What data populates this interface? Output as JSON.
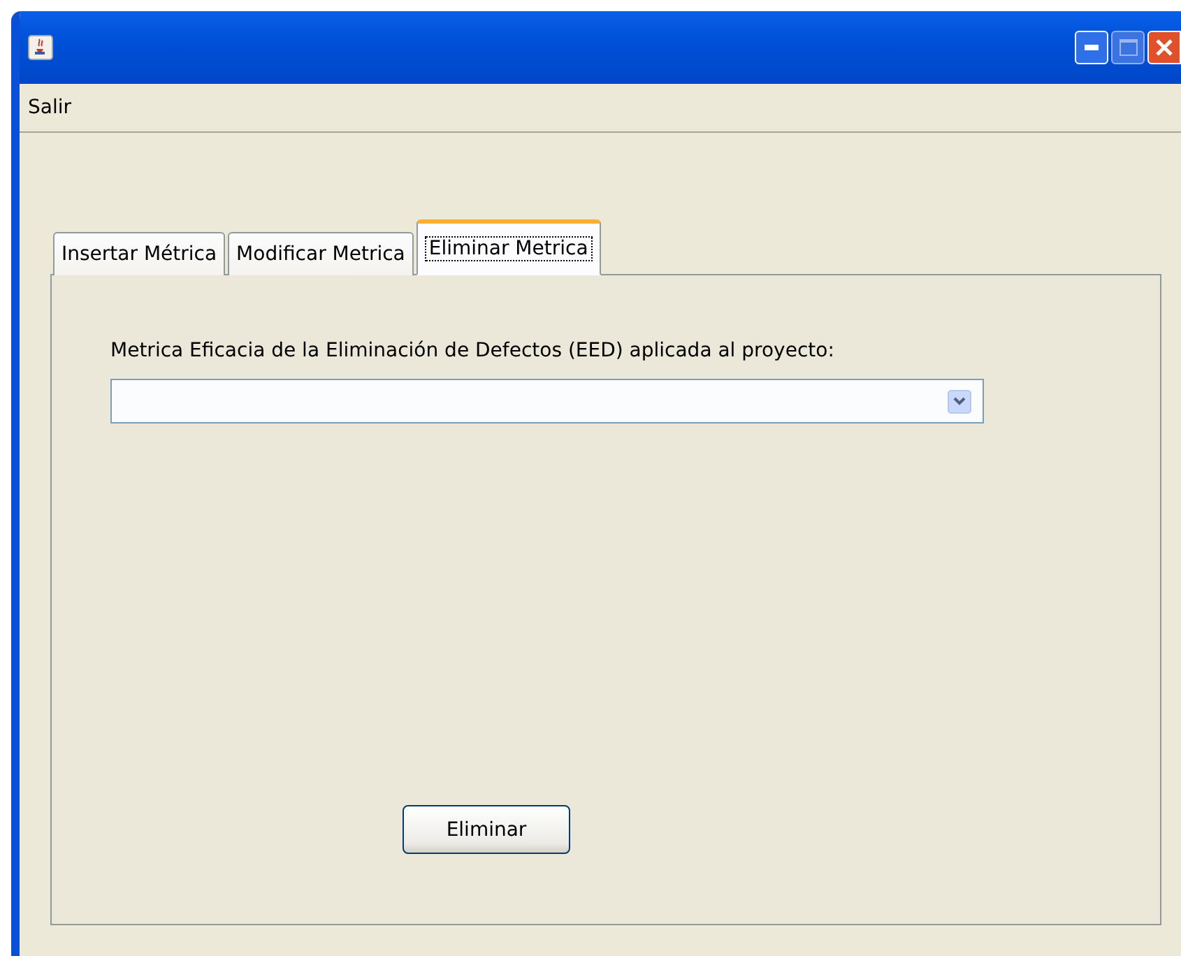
{
  "menu_bar": {
    "items": [
      {
        "label": "Salir"
      }
    ]
  },
  "tabs": [
    {
      "label": "Insertar Métrica",
      "selected": false
    },
    {
      "label": "Modificar Metrica",
      "selected": false
    },
    {
      "label": "Eliminar Metrica",
      "selected": true
    }
  ],
  "form": {
    "label": "Metrica Eficacia de la Eliminación de Defectos (EED) aplicada al proyecto:",
    "button": "Eliminar"
  }
}
